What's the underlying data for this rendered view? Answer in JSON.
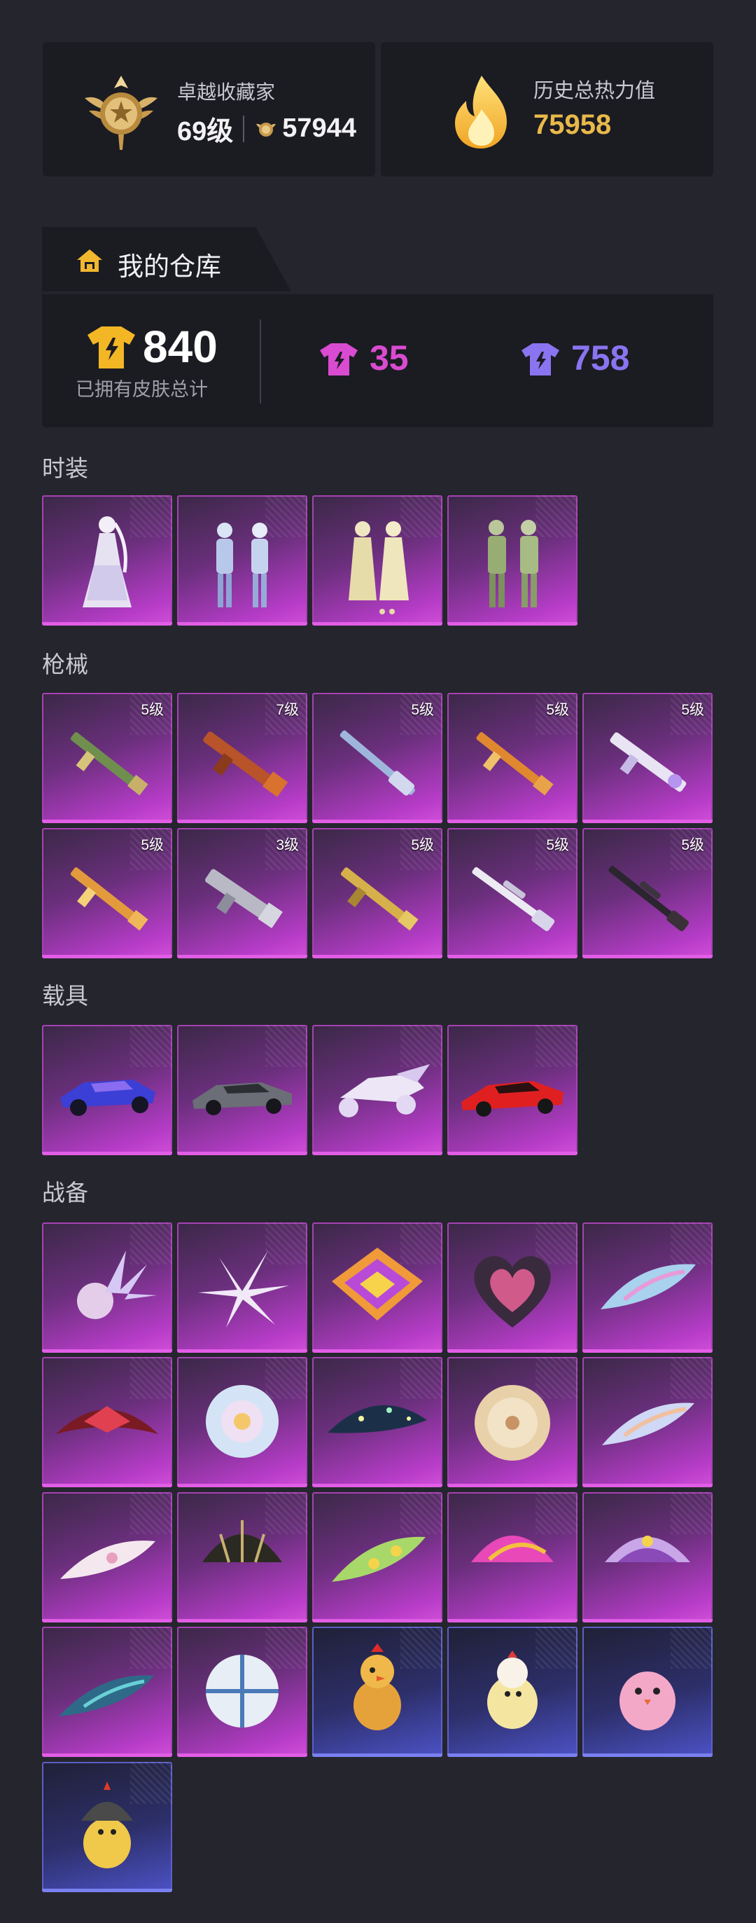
{
  "profile": {
    "collector_title": "卓越收藏家",
    "level": "69级",
    "collector_points": "57944"
  },
  "heat": {
    "title": "历史总热力值",
    "value": "75958"
  },
  "warehouse": {
    "tab_label": "我的仓库",
    "total_count": "840",
    "total_label": "已拥有皮肤总计",
    "legendary_count": "35",
    "epic_count": "758"
  },
  "colors": {
    "background": "#25252d",
    "panel": "#1b1b22",
    "gold": "#e8b94a",
    "legendary": "#d94bd0",
    "epic": "#8a74f0"
  },
  "sections": {
    "outfits": {
      "title": "时装",
      "items": [
        {
          "name": "white-dress-outfit"
        },
        {
          "name": "ice-armor-outfit"
        },
        {
          "name": "cream-robe-outfit"
        },
        {
          "name": "green-military-outfit"
        }
      ]
    },
    "guns": {
      "title": "枪械",
      "items": [
        {
          "name": "ak-camo-skin",
          "level": "5级"
        },
        {
          "name": "orange-rifle-skin",
          "level": "7级"
        },
        {
          "name": "blue-shotgun-skin",
          "level": "5级"
        },
        {
          "name": "orange-ak-skin",
          "level": "5级"
        },
        {
          "name": "white-smg-skin",
          "level": "5级"
        },
        {
          "name": "golden-ak-skin",
          "level": "5级"
        },
        {
          "name": "silver-vector-skin",
          "level": "3级"
        },
        {
          "name": "gold-rifle-skin",
          "level": "5级"
        },
        {
          "name": "white-sniper-skin",
          "level": "5级"
        },
        {
          "name": "dark-sniper-skin",
          "level": "5级"
        }
      ]
    },
    "vehicles": {
      "title": "载具",
      "items": [
        {
          "name": "blue-racer-skin"
        },
        {
          "name": "grey-sports-car-skin"
        },
        {
          "name": "white-motorbike-skin"
        },
        {
          "name": "red-supercar-skin"
        }
      ]
    },
    "gear": {
      "title": "战备",
      "items": [
        {
          "name": "crystal-parachute"
        },
        {
          "name": "star-glider"
        },
        {
          "name": "rainbow-kite-glider"
        },
        {
          "name": "heart-parachute"
        },
        {
          "name": "blue-glider"
        },
        {
          "name": "red-wing-glider"
        },
        {
          "name": "flower-parachute"
        },
        {
          "name": "night-sky-glider"
        },
        {
          "name": "cookie-parachute"
        },
        {
          "name": "pastel-glider"
        },
        {
          "name": "sakura-glider"
        },
        {
          "name": "black-gold-parachute"
        },
        {
          "name": "green-glider"
        },
        {
          "name": "pink-parachute"
        },
        {
          "name": "purple-parachute"
        },
        {
          "name": "teal-glider"
        },
        {
          "name": "white-blue-parachute"
        },
        {
          "name": "chicken-pet"
        },
        {
          "name": "chick-pet"
        },
        {
          "name": "pink-bird-pet"
        },
        {
          "name": "helmet-chick-pet"
        }
      ]
    }
  }
}
